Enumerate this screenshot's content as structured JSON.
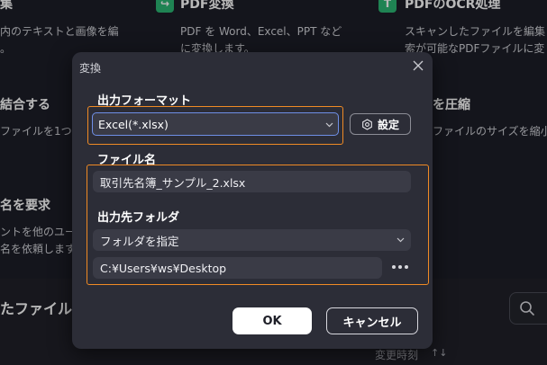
{
  "background": {
    "tools": [
      {
        "title": "集",
        "desc": [
          "内のテキストと画像を編",
          "。"
        ]
      },
      {
        "title": "PDF変換",
        "desc": [
          "PDF を Word、Excel、PPT など",
          "に変換します。"
        ]
      },
      {
        "title": "PDFのOCR処理",
        "desc": [
          "スキャンしたファイルを編集",
          "索が可能なPDFファイルに変"
        ]
      },
      {
        "title": "結合する",
        "desc": [
          "ファイルを1つのF"
        ]
      },
      {
        "title": "を圧縮",
        "desc": [
          "ファイルのサイズを縮小"
        ]
      },
      {
        "title": "名を要求",
        "desc": [
          "ントを他のユー",
          "名を依頼します"
        ]
      }
    ],
    "recent_files_title": "たファイル",
    "sort_label": "変更時刻",
    "sort_icon": "↑↓"
  },
  "dialog": {
    "title": "変換",
    "output_format": {
      "label": "出力フォーマット",
      "value": "Excel(*.xlsx)",
      "settings_label": "設定"
    },
    "file_name": {
      "label": "ファイル名",
      "value": "取引先名簿_サンプル_2.xlsx"
    },
    "output_folder": {
      "label": "出力先フォルダ",
      "mode_value": "フォルダを指定",
      "path_value": "C:¥Users¥ws¥Desktop"
    },
    "ok_label": "OK",
    "cancel_label": "キャンセル"
  },
  "colors": {
    "accent_orange": "#f08a24",
    "focus_blue": "#6f8fe6",
    "dialog_bg": "#2c2d37",
    "field_bg": "#3a3b46"
  }
}
